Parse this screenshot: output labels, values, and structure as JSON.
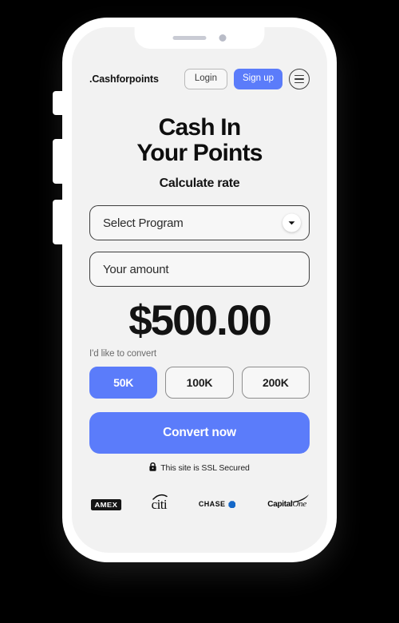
{
  "header": {
    "brand": ".Cashforpoints",
    "login_label": "Login",
    "signup_label": "Sign up",
    "menu_icon": "hamburger-menu-icon"
  },
  "hero": {
    "title_line1": "Cash In",
    "title_line2": "Your Points",
    "subtitle": "Calculate rate"
  },
  "form": {
    "program_select_value": "Select Program",
    "program_select_icon": "chevron-down-icon",
    "amount_placeholder": "Your amount"
  },
  "result": {
    "amount": "$500.00",
    "convert_label": "I'd like to convert"
  },
  "chips": [
    {
      "label": "50K",
      "selected": true
    },
    {
      "label": "100K",
      "selected": false
    },
    {
      "label": "200K",
      "selected": false
    }
  ],
  "cta": {
    "label": "Convert now"
  },
  "ssl": {
    "icon": "lock-icon",
    "text": "This site is SSL Secured"
  },
  "partners": [
    {
      "name": "AMEX"
    },
    {
      "name": "citi"
    },
    {
      "name": "CHASE"
    },
    {
      "name": "Capital",
      "name2": "One"
    }
  ],
  "colors": {
    "accent_blue": "#5b7cfa",
    "screen_bg": "#f2f2f2",
    "frame": "#ffffff",
    "page_bg": "#000000",
    "chase_blue": "#1568c8",
    "text_dark": "#111111"
  }
}
